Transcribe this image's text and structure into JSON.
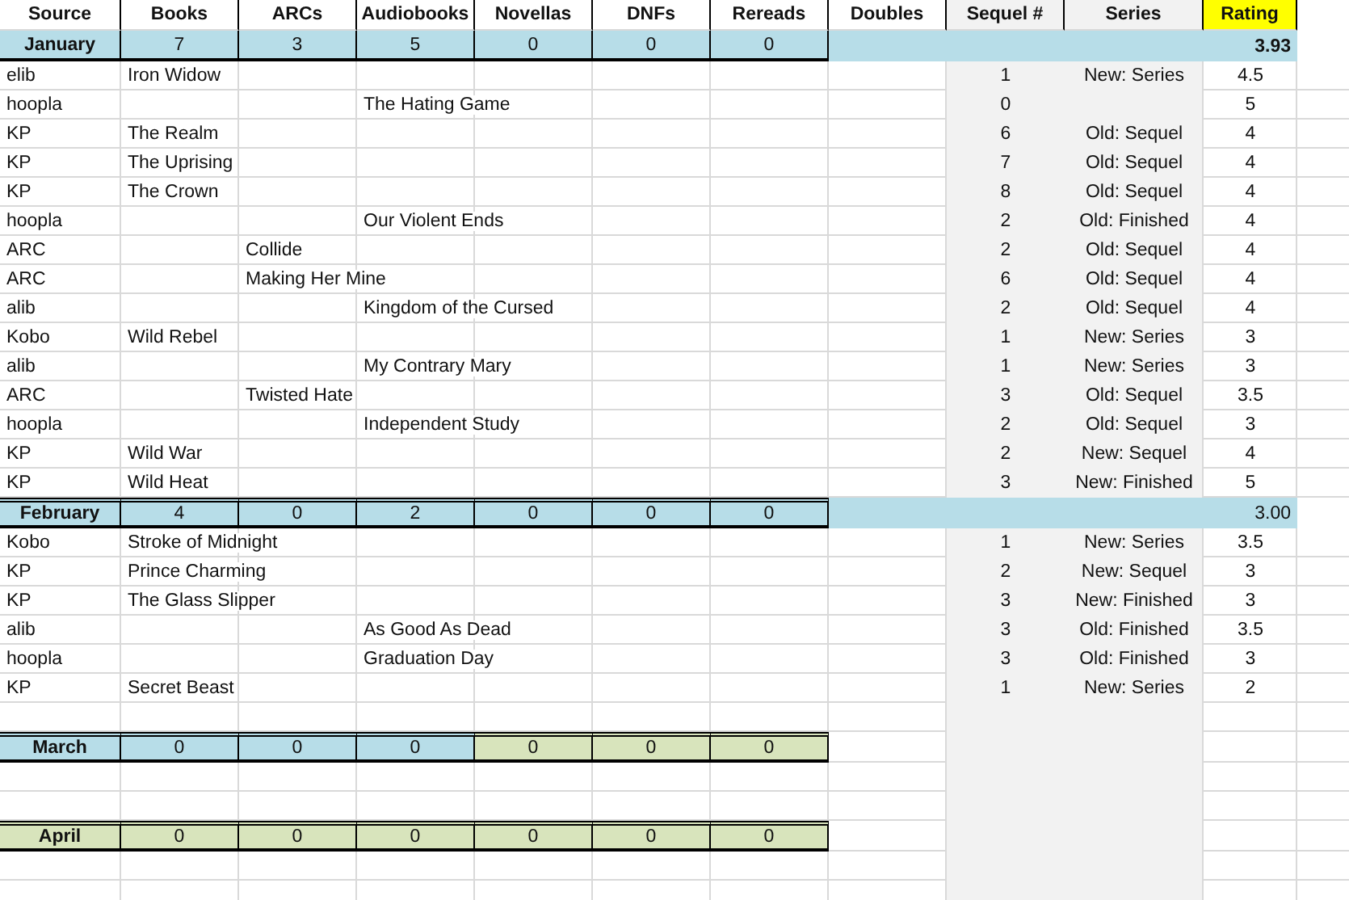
{
  "columns": [
    "Source",
    "Books",
    "ARCs",
    "Audiobooks",
    "Novellas",
    "DNFs",
    "Rereads",
    "Doubles",
    "Sequel #",
    "Series",
    "Rating"
  ],
  "months": [
    {
      "name": "January",
      "color": "#b7dde8",
      "counts": [
        {
          "value": "7",
          "color": "#b7dde8"
        },
        {
          "value": "3",
          "color": "#b7dde8"
        },
        {
          "value": "5",
          "color": "#b7dde8"
        },
        {
          "value": "0",
          "color": "#b7dde8"
        },
        {
          "value": "0",
          "color": "#b7dde8"
        },
        {
          "value": "0",
          "color": "#b7dde8"
        }
      ],
      "average": "3.93",
      "average_bold": true,
      "books": [
        {
          "source": "elib",
          "kind": "books",
          "title": "Iron Widow",
          "sequel": "1",
          "series": "New: Series",
          "rating": "4.5"
        },
        {
          "source": "hoopla",
          "kind": "audiobooks",
          "title": "The Hating Game",
          "sequel": "0",
          "rating": "5"
        },
        {
          "source": "KP",
          "kind": "books",
          "title": "The Realm",
          "sequel": "6",
          "series": "Old: Sequel",
          "rating": "4"
        },
        {
          "source": "KP",
          "kind": "books",
          "title": "The Uprising",
          "sequel": "7",
          "series": "Old: Sequel",
          "rating": "4"
        },
        {
          "source": "KP",
          "kind": "books",
          "title": "The Crown",
          "sequel": "8",
          "series": "Old: Sequel",
          "rating": "4"
        },
        {
          "source": "hoopla",
          "kind": "audiobooks",
          "title": "Our Violent Ends",
          "sequel": "2",
          "series": "Old: Finished",
          "rating": "4"
        },
        {
          "source": "ARC",
          "kind": "arcs",
          "title": "Collide",
          "sequel": "2",
          "series": "Old: Sequel",
          "rating": "4"
        },
        {
          "source": "ARC",
          "kind": "arcs",
          "title": "Making Her Mine",
          "sequel": "6",
          "series": "Old: Sequel",
          "rating": "4"
        },
        {
          "source": "alib",
          "kind": "audiobooks",
          "title": "Kingdom of the Cursed",
          "sequel": "2",
          "series": "Old: Sequel",
          "rating": "4"
        },
        {
          "source": "Kobo",
          "kind": "books",
          "title": "Wild Rebel",
          "sequel": "1",
          "series": "New: Series",
          "rating": "3"
        },
        {
          "source": "alib",
          "kind": "audiobooks",
          "title": "My Contrary Mary",
          "sequel": "1",
          "series": "New: Series",
          "rating": "3"
        },
        {
          "source": "ARC",
          "kind": "arcs",
          "title": "Twisted Hate",
          "sequel": "3",
          "series": "Old: Sequel",
          "rating": "3.5"
        },
        {
          "source": "hoopla",
          "kind": "audiobooks",
          "title": "Independent Study",
          "sequel": "2",
          "series": "Old: Sequel",
          "rating": "3"
        },
        {
          "source": "KP",
          "kind": "books",
          "title": "Wild War",
          "sequel": "2",
          "series": "New: Sequel",
          "rating": "4"
        },
        {
          "source": "KP",
          "kind": "books",
          "title": "Wild Heat",
          "sequel": "3",
          "series": "New: Finished",
          "rating": "5"
        }
      ]
    },
    {
      "name": "February",
      "color": "#b7dde8",
      "counts": [
        {
          "value": "4",
          "color": "#b7dde8"
        },
        {
          "value": "0",
          "color": "#b7dde8"
        },
        {
          "value": "2",
          "color": "#b7dde8"
        },
        {
          "value": "0",
          "color": "#b7dde8"
        },
        {
          "value": "0",
          "color": "#b7dde8"
        },
        {
          "value": "0",
          "color": "#b7dde8"
        }
      ],
      "average": "3.00",
      "average_bold": false,
      "books": [
        {
          "source": "Kobo",
          "kind": "books",
          "title": "Stroke of Midnight",
          "sequel": "1",
          "series": "New: Series",
          "rating": "3.5"
        },
        {
          "source": "KP",
          "kind": "books",
          "title": "Prince Charming",
          "sequel": "2",
          "series": "New: Sequel",
          "rating": "3"
        },
        {
          "source": "KP",
          "kind": "books",
          "title": "The Glass Slipper",
          "sequel": "3",
          "series": "New: Finished",
          "rating": "3"
        },
        {
          "source": "alib",
          "kind": "audiobooks",
          "title": "As Good As Dead",
          "sequel": "3",
          "series": "Old: Finished",
          "rating": "3.5"
        },
        {
          "source": "hoopla",
          "kind": "audiobooks",
          "title": "Graduation Day",
          "sequel": "3",
          "series": "Old: Finished",
          "rating": "3"
        },
        {
          "source": "KP",
          "kind": "books",
          "title": "Secret Beast",
          "sequel": "1",
          "series": "New: Series",
          "rating": "2"
        }
      ]
    },
    {
      "name": "March",
      "color": "#b7dde8",
      "counts": [
        {
          "value": "0",
          "color": "#b7dde8"
        },
        {
          "value": "0",
          "color": "#b7dde8"
        },
        {
          "value": "0",
          "color": "#b7dde8"
        },
        {
          "value": "0",
          "color": "#d8e4bc"
        },
        {
          "value": "0",
          "color": "#d8e4bc"
        },
        {
          "value": "0",
          "color": "#d8e4bc"
        }
      ]
    },
    {
      "name": "April",
      "color": "#d8e4bc",
      "counts": [
        {
          "value": "0",
          "color": "#d8e4bc"
        },
        {
          "value": "0",
          "color": "#d8e4bc"
        },
        {
          "value": "0",
          "color": "#d8e4bc"
        },
        {
          "value": "0",
          "color": "#d8e4bc"
        },
        {
          "value": "0",
          "color": "#d8e4bc"
        },
        {
          "value": "0",
          "color": "#d8e4bc"
        }
      ]
    }
  ]
}
